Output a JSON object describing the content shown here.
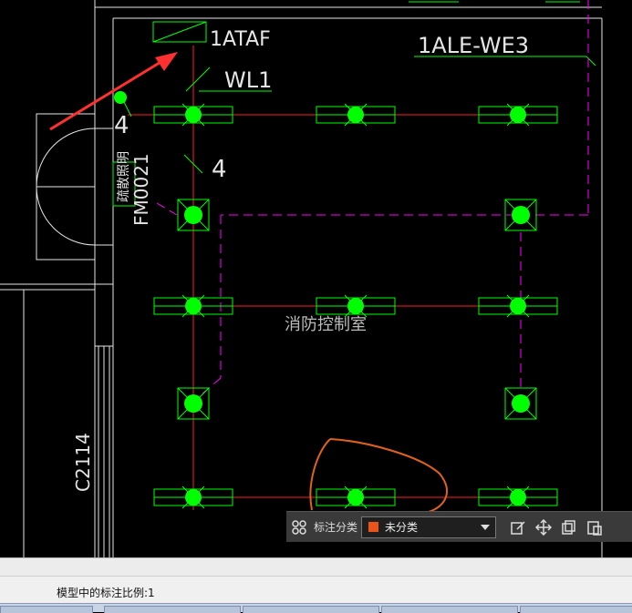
{
  "drawing": {
    "panel_tag": "1ATAF",
    "circuit_label": "1ALE-WE3",
    "wire_label": "WL1",
    "wire_count_top": "4",
    "wire_count_mid": "4",
    "door_tag": "FM0021",
    "room_name": "消防控制室",
    "side_tag": "C2114",
    "vertical_label": "疏散照明"
  },
  "toolbar": {
    "category_label": "标注分类",
    "category_value": "未分类",
    "category_color": "#e8541a"
  },
  "status": {
    "scale_text": "模型中的标注比例:1"
  },
  "colors": {
    "light_fixture": "#00ff00",
    "power_line": "#ff2020",
    "circuit_line": "#ff00ff",
    "drawing_line": "#e6e6e6",
    "annotation_arrow": "#ff3030",
    "annotation_circle": "#e0621a"
  }
}
